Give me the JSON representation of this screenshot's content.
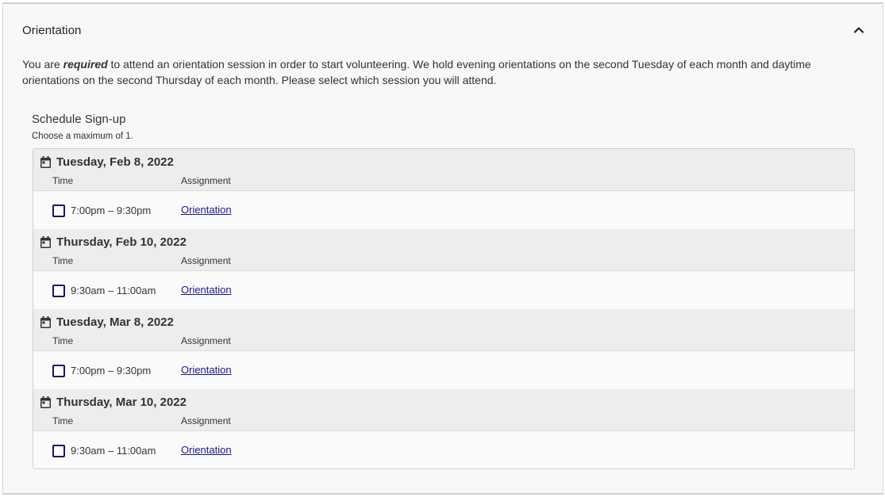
{
  "section": {
    "title": "Orientation",
    "collapse_icon": "chevron-up-icon"
  },
  "description": {
    "prefix": "You are ",
    "emphasis": "required",
    "suffix": " to attend an orientation session in order to start volunteering. We hold evening orientations on the second Tuesday of each month and daytime orientations on the second Thursday of each month. Please select which session you will attend."
  },
  "schedule": {
    "title": "Schedule Sign-up",
    "hint": "Choose a maximum of 1.",
    "days": [
      {
        "date": "Tuesday, Feb 8, 2022",
        "time_header": "Time",
        "assignment_header": "Assignment",
        "slot": {
          "time": "7:00pm – 9:30pm",
          "assignment": "Orientation",
          "checked": false
        }
      },
      {
        "date": "Thursday, Feb 10, 2022",
        "time_header": "Time",
        "assignment_header": "Assignment",
        "slot": {
          "time": "9:30am – 11:00am",
          "assignment": "Orientation",
          "checked": false
        }
      },
      {
        "date": "Tuesday, Mar 8, 2022",
        "time_header": "Time",
        "assignment_header": "Assignment",
        "slot": {
          "time": "7:00pm – 9:30pm",
          "assignment": "Orientation",
          "checked": false
        }
      },
      {
        "date": "Thursday, Mar 10, 2022",
        "time_header": "Time",
        "assignment_header": "Assignment",
        "slot": {
          "time": "9:30am – 11:00am",
          "assignment": "Orientation",
          "checked": false
        }
      }
    ]
  },
  "colors": {
    "accent": "#1b1464",
    "link": "#1b1490",
    "day_header_bg": "#ededed"
  }
}
